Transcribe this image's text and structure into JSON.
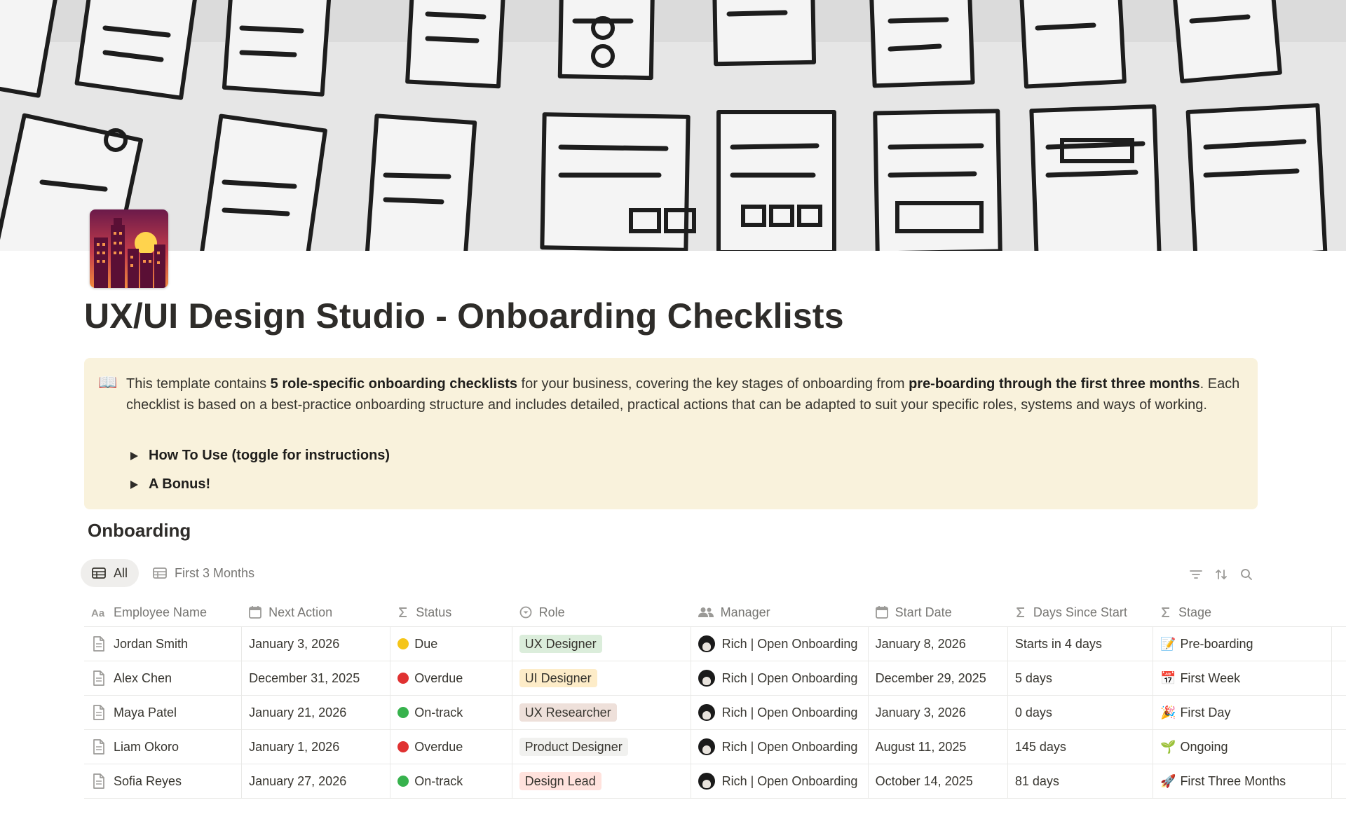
{
  "page": {
    "title": "UX/UI Design Studio - Onboarding Checklists"
  },
  "callout": {
    "icon": "📖",
    "text_1": "This template contains ",
    "bold_1": "5 role-specific onboarding checklists",
    "text_2": " for your business, covering the key stages of onboarding from ",
    "bold_2": "pre-boarding through the first three months",
    "text_3": ". Each checklist is based on a best-practice onboarding structure and includes detailed, practical actions that can be adapted to suit your specific roles, systems and ways of working.",
    "toggles": [
      "How To Use (toggle for instructions)",
      "A Bonus!"
    ]
  },
  "database": {
    "title": "Onboarding",
    "views": [
      "All",
      "First 3 Months"
    ],
    "columns": [
      "Employee Name",
      "Next Action",
      "Status",
      "Role",
      "Manager",
      "Start Date",
      "Days Since Start",
      "Stage"
    ],
    "rows": [
      {
        "name": "Jordan Smith",
        "next_action": "January 3, 2026",
        "status": "Due",
        "status_color": "#f5c518",
        "role": "UX Designer",
        "role_bg": "#dbeddb",
        "manager": "Rich | Open Onboarding",
        "start_date": "January 8, 2026",
        "days": "Starts in 4 days",
        "stage_icon": "📝",
        "stage": "Pre-boarding"
      },
      {
        "name": "Alex Chen",
        "next_action": "December 31, 2025",
        "status": "Overdue",
        "status_color": "#e03131",
        "role": "UI Designer",
        "role_bg": "#fdecc8",
        "manager": "Rich | Open Onboarding",
        "start_date": "December 29, 2025",
        "days": "5 days",
        "stage_icon": "📅",
        "stage": "First Week"
      },
      {
        "name": "Maya Patel",
        "next_action": "January 21, 2026",
        "status": "On-track",
        "status_color": "#37b24d",
        "role": "UX Researcher",
        "role_bg": "#eee0da",
        "manager": "Rich | Open Onboarding",
        "start_date": "January 3, 2026",
        "days": "0 days",
        "stage_icon": "🎉",
        "stage": "First Day"
      },
      {
        "name": "Liam Okoro",
        "next_action": "January 1, 2026",
        "status": "Overdue",
        "status_color": "#e03131",
        "role": "Product Designer",
        "role_bg": "#f1f1ef",
        "manager": "Rich | Open Onboarding",
        "start_date": "August 11, 2025",
        "days": "145 days",
        "stage_icon": "🌱",
        "stage": "Ongoing"
      },
      {
        "name": "Sofia Reyes",
        "next_action": "January 27, 2026",
        "status": "On-track",
        "status_color": "#37b24d",
        "role": "Design Lead",
        "role_bg": "#ffe2dd",
        "manager": "Rich | Open Onboarding",
        "start_date": "October 14, 2025",
        "days": "81 days",
        "stage_icon": "🚀",
        "stage": "First Three Months"
      }
    ]
  }
}
